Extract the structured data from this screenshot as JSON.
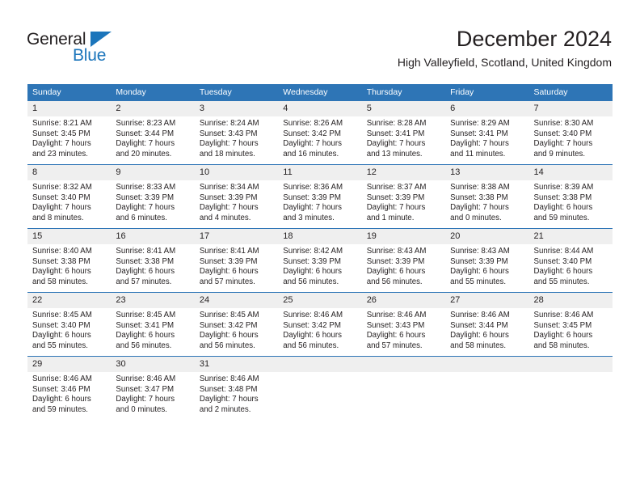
{
  "brand": {
    "name_part1": "General",
    "name_part2": "Blue",
    "accent_color": "#1b75bb"
  },
  "header": {
    "title": "December 2024",
    "location": "High Valleyfield, Scotland, United Kingdom"
  },
  "calendar": {
    "header_color": "#2e75b6",
    "daynum_background": "#efefef",
    "weekdays": [
      "Sunday",
      "Monday",
      "Tuesday",
      "Wednesday",
      "Thursday",
      "Friday",
      "Saturday"
    ],
    "weeks": [
      [
        {
          "day": "1",
          "sunrise": "Sunrise: 8:21 AM",
          "sunset": "Sunset: 3:45 PM",
          "daylight_line1": "Daylight: 7 hours",
          "daylight_line2": "and 23 minutes."
        },
        {
          "day": "2",
          "sunrise": "Sunrise: 8:23 AM",
          "sunset": "Sunset: 3:44 PM",
          "daylight_line1": "Daylight: 7 hours",
          "daylight_line2": "and 20 minutes."
        },
        {
          "day": "3",
          "sunrise": "Sunrise: 8:24 AM",
          "sunset": "Sunset: 3:43 PM",
          "daylight_line1": "Daylight: 7 hours",
          "daylight_line2": "and 18 minutes."
        },
        {
          "day": "4",
          "sunrise": "Sunrise: 8:26 AM",
          "sunset": "Sunset: 3:42 PM",
          "daylight_line1": "Daylight: 7 hours",
          "daylight_line2": "and 16 minutes."
        },
        {
          "day": "5",
          "sunrise": "Sunrise: 8:28 AM",
          "sunset": "Sunset: 3:41 PM",
          "daylight_line1": "Daylight: 7 hours",
          "daylight_line2": "and 13 minutes."
        },
        {
          "day": "6",
          "sunrise": "Sunrise: 8:29 AM",
          "sunset": "Sunset: 3:41 PM",
          "daylight_line1": "Daylight: 7 hours",
          "daylight_line2": "and 11 minutes."
        },
        {
          "day": "7",
          "sunrise": "Sunrise: 8:30 AM",
          "sunset": "Sunset: 3:40 PM",
          "daylight_line1": "Daylight: 7 hours",
          "daylight_line2": "and 9 minutes."
        }
      ],
      [
        {
          "day": "8",
          "sunrise": "Sunrise: 8:32 AM",
          "sunset": "Sunset: 3:40 PM",
          "daylight_line1": "Daylight: 7 hours",
          "daylight_line2": "and 8 minutes."
        },
        {
          "day": "9",
          "sunrise": "Sunrise: 8:33 AM",
          "sunset": "Sunset: 3:39 PM",
          "daylight_line1": "Daylight: 7 hours",
          "daylight_line2": "and 6 minutes."
        },
        {
          "day": "10",
          "sunrise": "Sunrise: 8:34 AM",
          "sunset": "Sunset: 3:39 PM",
          "daylight_line1": "Daylight: 7 hours",
          "daylight_line2": "and 4 minutes."
        },
        {
          "day": "11",
          "sunrise": "Sunrise: 8:36 AM",
          "sunset": "Sunset: 3:39 PM",
          "daylight_line1": "Daylight: 7 hours",
          "daylight_line2": "and 3 minutes."
        },
        {
          "day": "12",
          "sunrise": "Sunrise: 8:37 AM",
          "sunset": "Sunset: 3:39 PM",
          "daylight_line1": "Daylight: 7 hours",
          "daylight_line2": "and 1 minute."
        },
        {
          "day": "13",
          "sunrise": "Sunrise: 8:38 AM",
          "sunset": "Sunset: 3:38 PM",
          "daylight_line1": "Daylight: 7 hours",
          "daylight_line2": "and 0 minutes."
        },
        {
          "day": "14",
          "sunrise": "Sunrise: 8:39 AM",
          "sunset": "Sunset: 3:38 PM",
          "daylight_line1": "Daylight: 6 hours",
          "daylight_line2": "and 59 minutes."
        }
      ],
      [
        {
          "day": "15",
          "sunrise": "Sunrise: 8:40 AM",
          "sunset": "Sunset: 3:38 PM",
          "daylight_line1": "Daylight: 6 hours",
          "daylight_line2": "and 58 minutes."
        },
        {
          "day": "16",
          "sunrise": "Sunrise: 8:41 AM",
          "sunset": "Sunset: 3:38 PM",
          "daylight_line1": "Daylight: 6 hours",
          "daylight_line2": "and 57 minutes."
        },
        {
          "day": "17",
          "sunrise": "Sunrise: 8:41 AM",
          "sunset": "Sunset: 3:39 PM",
          "daylight_line1": "Daylight: 6 hours",
          "daylight_line2": "and 57 minutes."
        },
        {
          "day": "18",
          "sunrise": "Sunrise: 8:42 AM",
          "sunset": "Sunset: 3:39 PM",
          "daylight_line1": "Daylight: 6 hours",
          "daylight_line2": "and 56 minutes."
        },
        {
          "day": "19",
          "sunrise": "Sunrise: 8:43 AM",
          "sunset": "Sunset: 3:39 PM",
          "daylight_line1": "Daylight: 6 hours",
          "daylight_line2": "and 56 minutes."
        },
        {
          "day": "20",
          "sunrise": "Sunrise: 8:43 AM",
          "sunset": "Sunset: 3:39 PM",
          "daylight_line1": "Daylight: 6 hours",
          "daylight_line2": "and 55 minutes."
        },
        {
          "day": "21",
          "sunrise": "Sunrise: 8:44 AM",
          "sunset": "Sunset: 3:40 PM",
          "daylight_line1": "Daylight: 6 hours",
          "daylight_line2": "and 55 minutes."
        }
      ],
      [
        {
          "day": "22",
          "sunrise": "Sunrise: 8:45 AM",
          "sunset": "Sunset: 3:40 PM",
          "daylight_line1": "Daylight: 6 hours",
          "daylight_line2": "and 55 minutes."
        },
        {
          "day": "23",
          "sunrise": "Sunrise: 8:45 AM",
          "sunset": "Sunset: 3:41 PM",
          "daylight_line1": "Daylight: 6 hours",
          "daylight_line2": "and 56 minutes."
        },
        {
          "day": "24",
          "sunrise": "Sunrise: 8:45 AM",
          "sunset": "Sunset: 3:42 PM",
          "daylight_line1": "Daylight: 6 hours",
          "daylight_line2": "and 56 minutes."
        },
        {
          "day": "25",
          "sunrise": "Sunrise: 8:46 AM",
          "sunset": "Sunset: 3:42 PM",
          "daylight_line1": "Daylight: 6 hours",
          "daylight_line2": "and 56 minutes."
        },
        {
          "day": "26",
          "sunrise": "Sunrise: 8:46 AM",
          "sunset": "Sunset: 3:43 PM",
          "daylight_line1": "Daylight: 6 hours",
          "daylight_line2": "and 57 minutes."
        },
        {
          "day": "27",
          "sunrise": "Sunrise: 8:46 AM",
          "sunset": "Sunset: 3:44 PM",
          "daylight_line1": "Daylight: 6 hours",
          "daylight_line2": "and 58 minutes."
        },
        {
          "day": "28",
          "sunrise": "Sunrise: 8:46 AM",
          "sunset": "Sunset: 3:45 PM",
          "daylight_line1": "Daylight: 6 hours",
          "daylight_line2": "and 58 minutes."
        }
      ],
      [
        {
          "day": "29",
          "sunrise": "Sunrise: 8:46 AM",
          "sunset": "Sunset: 3:46 PM",
          "daylight_line1": "Daylight: 6 hours",
          "daylight_line2": "and 59 minutes."
        },
        {
          "day": "30",
          "sunrise": "Sunrise: 8:46 AM",
          "sunset": "Sunset: 3:47 PM",
          "daylight_line1": "Daylight: 7 hours",
          "daylight_line2": "and 0 minutes."
        },
        {
          "day": "31",
          "sunrise": "Sunrise: 8:46 AM",
          "sunset": "Sunset: 3:48 PM",
          "daylight_line1": "Daylight: 7 hours",
          "daylight_line2": "and 2 minutes."
        },
        {
          "day": "",
          "sunrise": "",
          "sunset": "",
          "daylight_line1": "",
          "daylight_line2": ""
        },
        {
          "day": "",
          "sunrise": "",
          "sunset": "",
          "daylight_line1": "",
          "daylight_line2": ""
        },
        {
          "day": "",
          "sunrise": "",
          "sunset": "",
          "daylight_line1": "",
          "daylight_line2": ""
        },
        {
          "day": "",
          "sunrise": "",
          "sunset": "",
          "daylight_line1": "",
          "daylight_line2": ""
        }
      ]
    ]
  }
}
